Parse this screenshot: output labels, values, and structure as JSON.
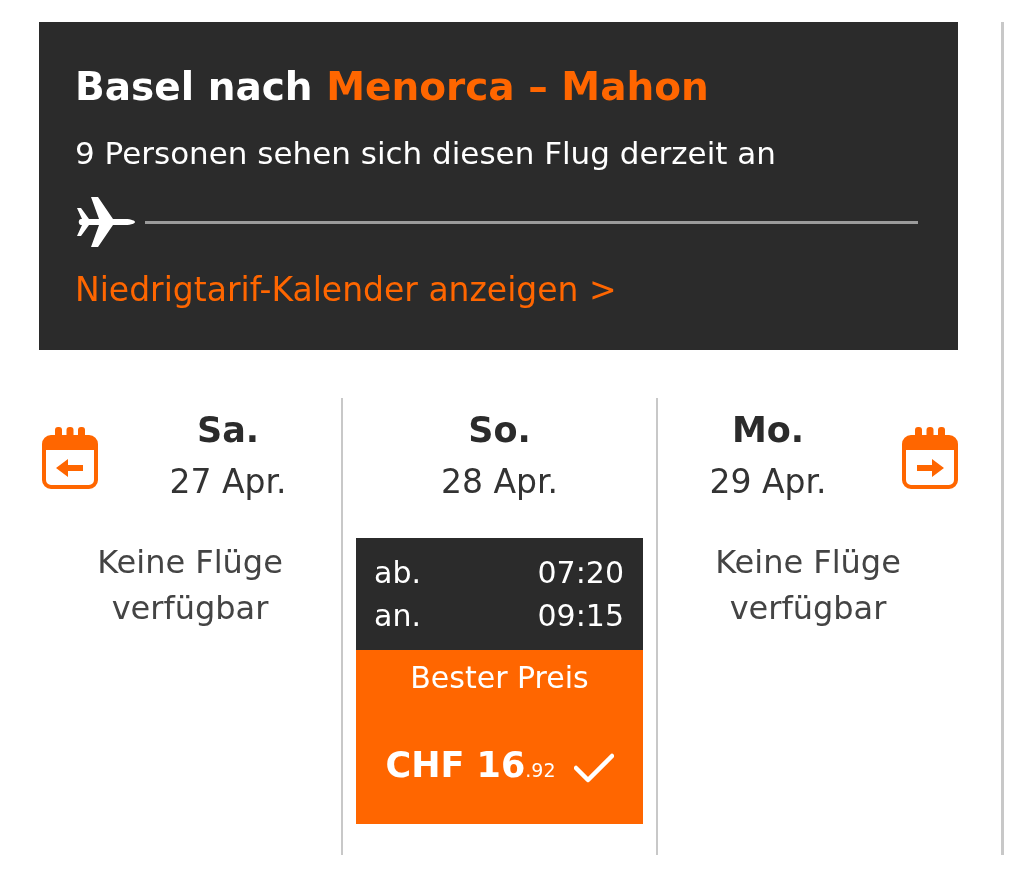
{
  "route": {
    "origin": "Basel nach",
    "destination": "Menorca – Mahon",
    "viewers": "9 Personen sehen sich diesen Flug derzeit an",
    "calendar_link": "Niedrigtarif-Kalender anzeigen >"
  },
  "days": [
    {
      "kind": "no_flights",
      "weekday": "Sa.",
      "date": "27 Apr.",
      "message": "Keine Flüge verfügbar"
    },
    {
      "kind": "flight",
      "weekday": "So.",
      "date": "28 Apr.",
      "flight": {
        "departure_label": "ab.",
        "departure_time": "07:20",
        "arrival_label": "an.",
        "arrival_time": "09:15",
        "badge": "Bester Preis",
        "price": "CHF 16",
        "price_decimals": ".92",
        "selected": true
      }
    },
    {
      "kind": "no_flights",
      "weekday": "Mo.",
      "date": "29 Apr.",
      "message": "Keine Flüge verfügbar"
    }
  ]
}
